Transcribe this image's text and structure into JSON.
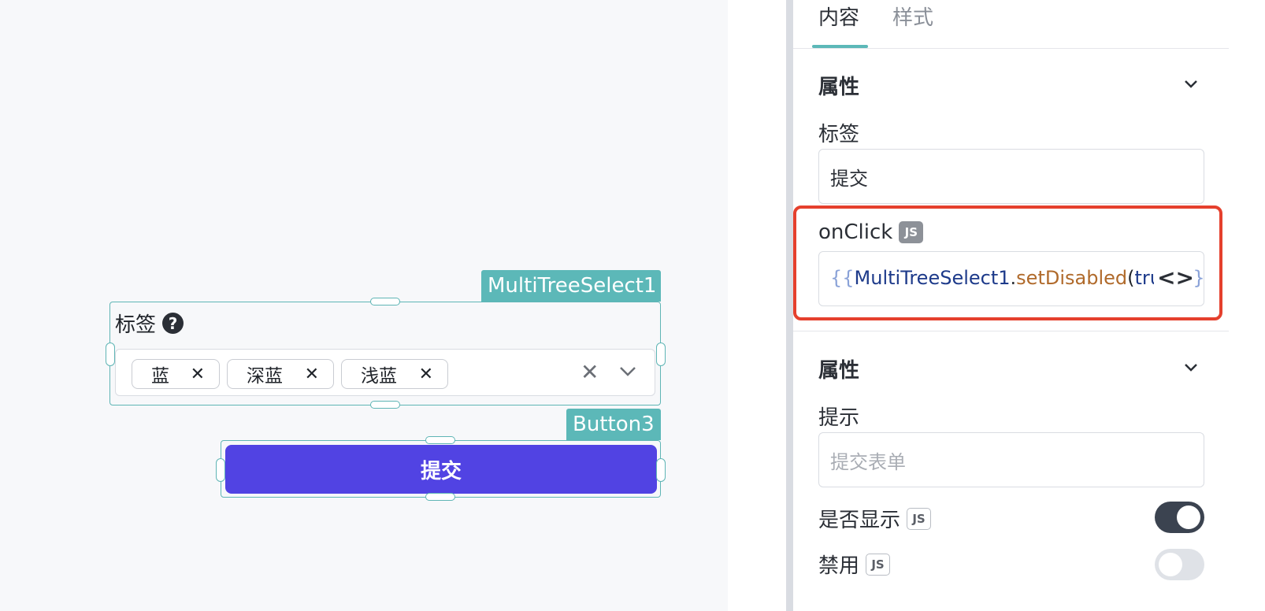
{
  "canvas": {
    "multi_tree_select": {
      "tag": "MultiTreeSelect1",
      "label": "标签",
      "chips": [
        "蓝",
        "深蓝",
        "浅蓝"
      ]
    },
    "button": {
      "tag": "Button3",
      "label": "提交"
    }
  },
  "panel": {
    "tabs": [
      {
        "label": "内容",
        "active": true
      },
      {
        "label": "样式",
        "active": false
      }
    ],
    "section1": {
      "title": "属性",
      "label_field": {
        "label": "标签",
        "value": "提交"
      },
      "onclick_field": {
        "label": "onClick",
        "badge": "JS",
        "code": {
          "open": "{{",
          "object": "MultiTreeSelect1",
          "dot": ".",
          "method": "setDisabled",
          "paren_open": "(",
          "arg": "true",
          "paren_close": ")",
          "close": "}}"
        }
      }
    },
    "section2": {
      "title": "属性",
      "tooltip_field": {
        "label": "提示",
        "placeholder": "提交表单"
      },
      "visible": {
        "label": "是否显示",
        "badge": "JS",
        "on": true
      },
      "disabled": {
        "label": "禁用",
        "badge": "JS",
        "on": false
      }
    }
  },
  "colors": {
    "accent_teal": "#5cb8b8",
    "primary_button": "#5143e3",
    "highlight_red": "#e5402d"
  }
}
